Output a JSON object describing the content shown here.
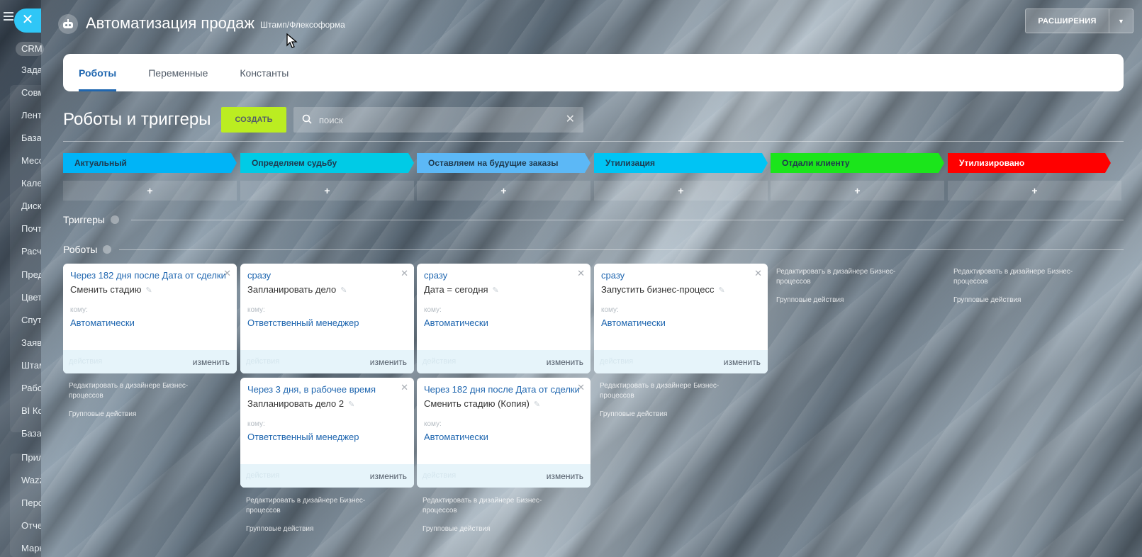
{
  "left_menu": {
    "crm_label": "CRM",
    "items": [
      "Задачи",
      "Совместная работа",
      "Лента",
      "База знаний",
      "Мессенджер",
      "Календарь",
      "Диск",
      "Почта",
      "Расчеты",
      "Предложения",
      "Цветы",
      "Спутники",
      "Заявки",
      "Штамп",
      "Работа",
      "BI Конструктор",
      "База",
      "Приложения",
      "Wazzup",
      "Персонал",
      "Отчеты",
      "Маркет"
    ]
  },
  "header": {
    "title": "Автоматизация продаж",
    "subtitle": "Штамп/Флексоформа",
    "extensions_label": "РАСШИРЕНИЯ"
  },
  "tabs": [
    {
      "label": "Роботы",
      "active": true
    },
    {
      "label": "Переменные",
      "active": false
    },
    {
      "label": "Константы",
      "active": false
    }
  ],
  "toolbar": {
    "title": "Роботы и триггеры",
    "create_label": "СОЗДАТЬ",
    "search_placeholder": "поиск"
  },
  "stages": [
    {
      "label": "Актуальный",
      "color": "#00b4f7",
      "text_color": "#1f3a4f"
    },
    {
      "label": "Определяем судьбу",
      "color": "#00cbe6",
      "text_color": "#1f3a4f"
    },
    {
      "label": "Оставляем на будущие заказы",
      "color": "#5cb8f6",
      "text_color": "#1f3a4f"
    },
    {
      "label": "Утилизация",
      "color": "#00c4f4",
      "text_color": "#1f3a4f"
    },
    {
      "label": "Отдали клиенту",
      "color": "#1be51b",
      "text_color": "#1f3a4f"
    },
    {
      "label": "Утилизировано",
      "color": "#ff0000",
      "text_color": "#ffffff"
    }
  ],
  "plus_label": "+",
  "sections": {
    "triggers_label": "Триггеры",
    "robots_label": "Роботы"
  },
  "cards": [
    {
      "condition": "Через 182 дня после Дата от сделки",
      "name": "Сменить стадию",
      "whom_label": "кому:",
      "responsible": "Автоматически",
      "actions_label": "действия",
      "edit_label": "изменить"
    },
    {
      "condition": "сразу",
      "name": "Запланировать дело",
      "whom_label": "кому:",
      "responsible": "Ответственный менеджер",
      "actions_label": "действия",
      "edit_label": "изменить"
    },
    {
      "condition": "сразу",
      "name": "Дата = сегодня",
      "whom_label": "кому:",
      "responsible": "Автоматически",
      "actions_label": "действия",
      "edit_label": "изменить"
    },
    {
      "condition": "сразу",
      "name": "Запустить бизнес-процесс",
      "whom_label": "кому:",
      "responsible": "Автоматически",
      "actions_label": "действия",
      "edit_label": "изменить"
    },
    {
      "condition": "Через 3 дня, в рабочее время",
      "name": "Запланировать дело 2",
      "whom_label": "кому:",
      "responsible": "Ответственный менеджер",
      "actions_label": "действия",
      "edit_label": "изменить"
    },
    {
      "condition": "Через 182 дня после Дата от сделки",
      "name": "Сменить стадию (Копия)",
      "whom_label": "кому:",
      "responsible": "Автоматически",
      "actions_label": "действия",
      "edit_label": "изменить"
    }
  ],
  "bp_links": {
    "designer": "Редактировать в дизайнере Бизнес-процессов",
    "group": "Групповые действия"
  }
}
